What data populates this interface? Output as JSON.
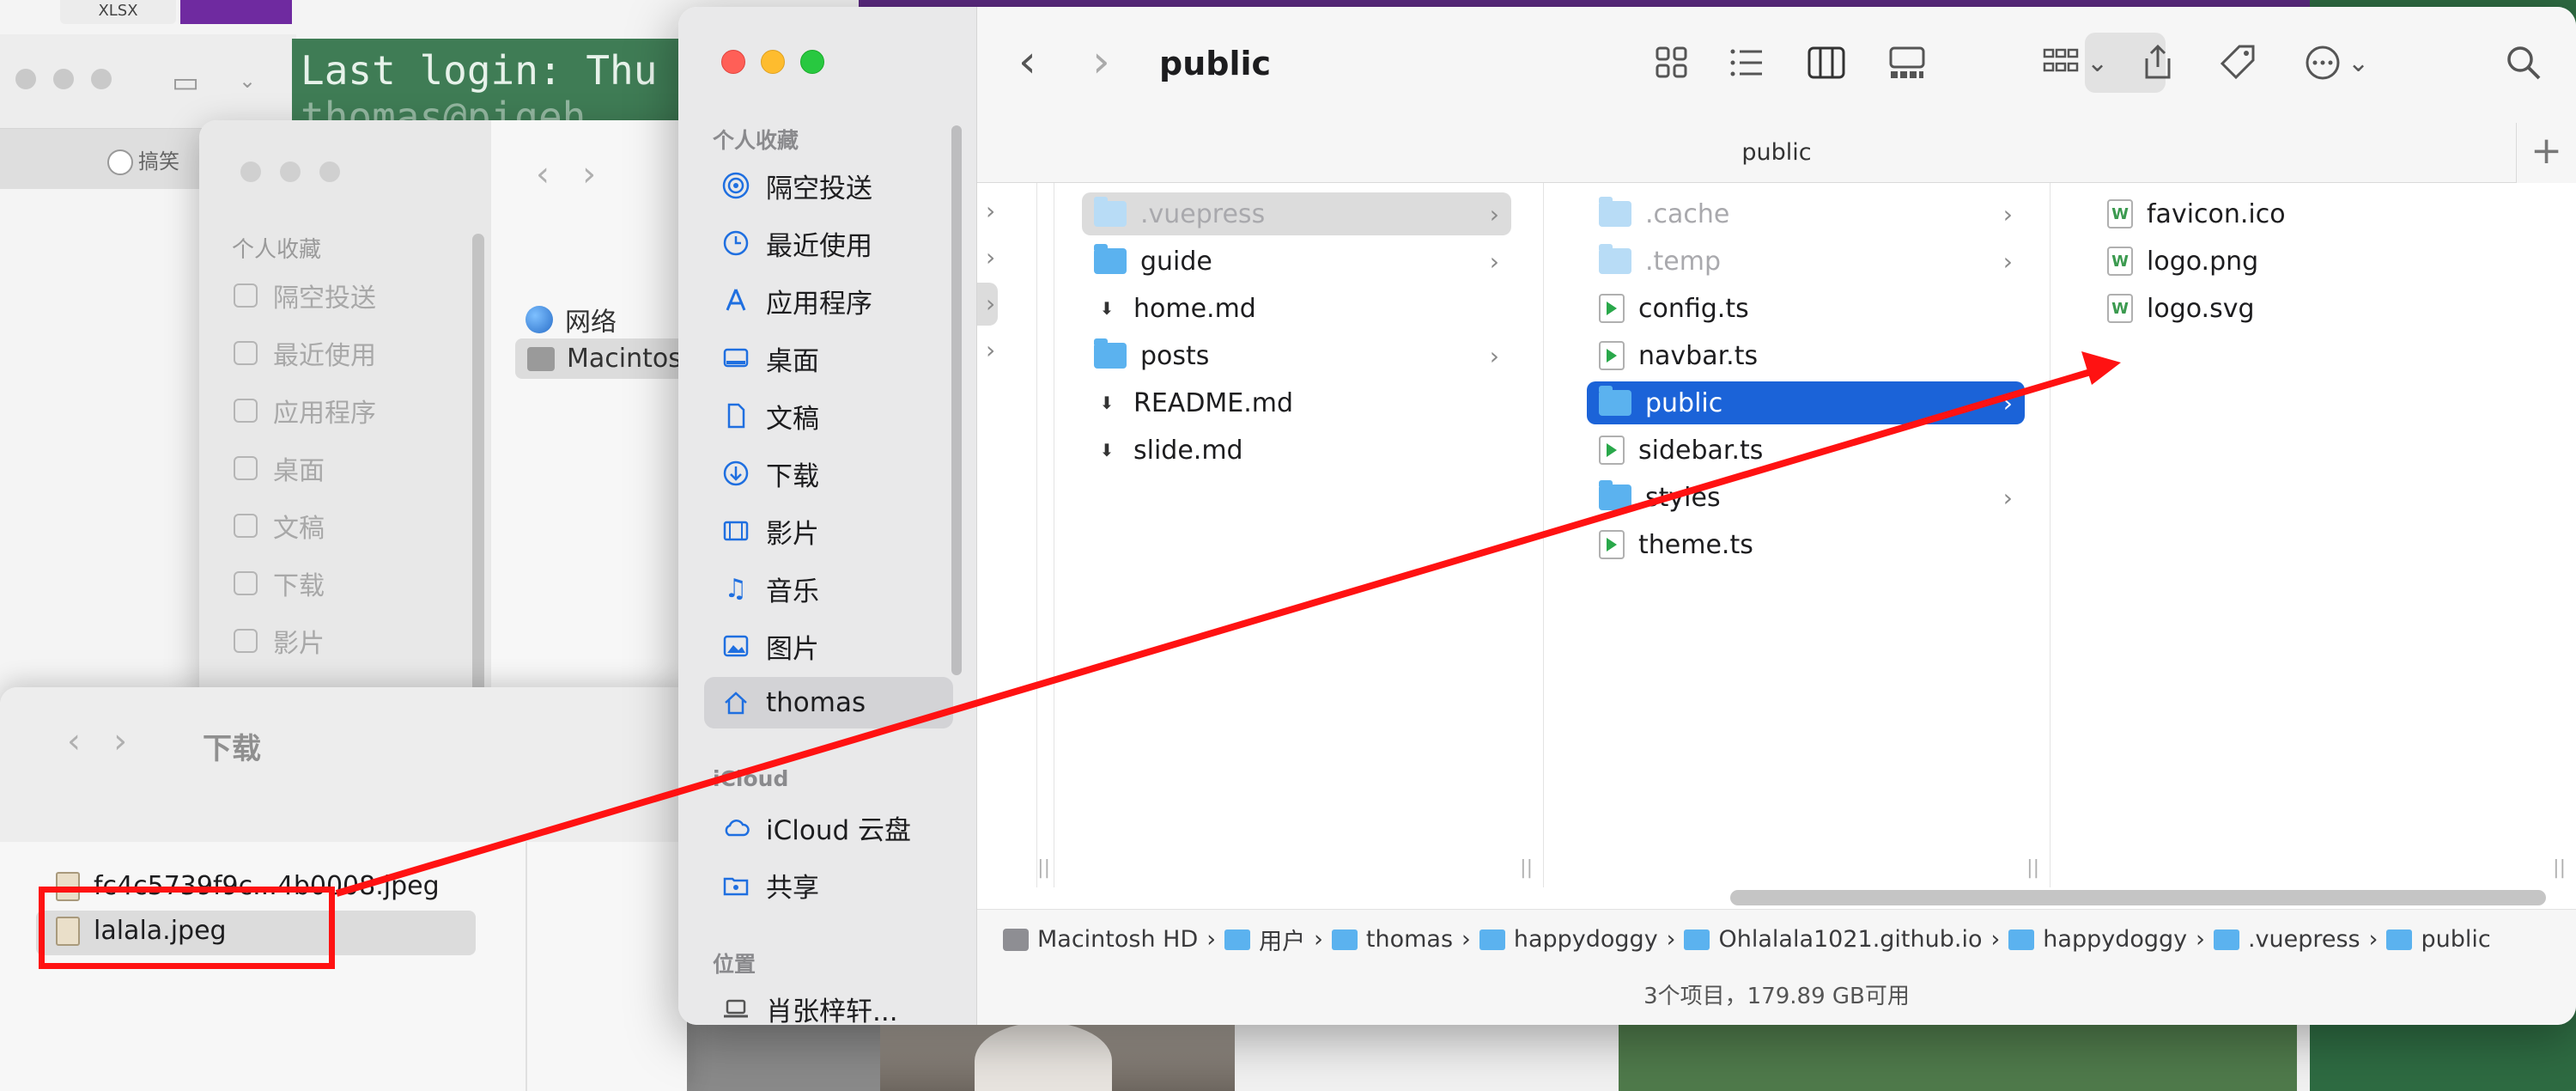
{
  "desktop": {
    "xlsx_chip": "XLSX",
    "baidu_tab": "搞笑",
    "terminal": {
      "line1": "Last login: Thu",
      "line2": "thomas@pigeh"
    }
  },
  "mid_window": {
    "sidebar_title": "个人收藏",
    "sidebar_items": [
      "隔空投送",
      "最近使用",
      "应用程序",
      "桌面",
      "文稿",
      "下载",
      "影片"
    ],
    "content_items": [
      "网络",
      "Macintos"
    ]
  },
  "downloads_window": {
    "title": "下载",
    "files": [
      "fc4c5739f9c...4b0008.jpeg",
      "lalala.jpeg"
    ],
    "selected_file": "lalala.jpeg"
  },
  "main_window": {
    "title": "public",
    "path_title": "public",
    "toolbar": {
      "back": "back-icon",
      "forward": "forward-icon",
      "view_icons": "icon-view-icon",
      "view_list": "list-view-icon",
      "view_columns": "column-view-icon",
      "view_gallery": "gallery-view-icon",
      "group": "group-icon",
      "share": "share-icon",
      "tag": "tag-icon",
      "more": "more-icon",
      "search": "search-icon"
    },
    "sidebar": {
      "favorites_title": "个人收藏",
      "favorites": [
        {
          "label": "隔空投送",
          "icon": "airdrop-icon"
        },
        {
          "label": "最近使用",
          "icon": "clock-icon"
        },
        {
          "label": "应用程序",
          "icon": "applications-icon"
        },
        {
          "label": "桌面",
          "icon": "desktop-icon"
        },
        {
          "label": "文稿",
          "icon": "document-icon"
        },
        {
          "label": "下载",
          "icon": "download-icon"
        },
        {
          "label": "影片",
          "icon": "film-icon"
        },
        {
          "label": "音乐",
          "icon": "music-icon"
        },
        {
          "label": "图片",
          "icon": "photo-icon"
        },
        {
          "label": "thomas",
          "icon": "home-icon"
        }
      ],
      "icloud_title": "iCloud",
      "icloud": [
        {
          "label": "iCloud 云盘",
          "icon": "cloud-icon"
        },
        {
          "label": "共享",
          "icon": "shared-folder-icon"
        }
      ],
      "locations_title": "位置",
      "locations": [
        {
          "label": "肖张梓轩...",
          "icon": "laptop-icon"
        }
      ]
    },
    "col2": [
      {
        "name": ".vuepress",
        "type": "folder",
        "dim": true,
        "highlight": "grey"
      },
      {
        "name": "guide",
        "type": "folder"
      },
      {
        "name": "home.md",
        "type": "md"
      },
      {
        "name": "posts",
        "type": "folder"
      },
      {
        "name": "README.md",
        "type": "md"
      },
      {
        "name": "slide.md",
        "type": "md"
      }
    ],
    "col3": [
      {
        "name": ".cache",
        "type": "folder",
        "dim": true
      },
      {
        "name": ".temp",
        "type": "folder",
        "dim": true
      },
      {
        "name": "config.ts",
        "type": "ts"
      },
      {
        "name": "navbar.ts",
        "type": "ts"
      },
      {
        "name": "public",
        "type": "folder",
        "highlight": "blue"
      },
      {
        "name": "sidebar.ts",
        "type": "ts"
      },
      {
        "name": "styles",
        "type": "folder"
      },
      {
        "name": "theme.ts",
        "type": "ts"
      }
    ],
    "col4": [
      {
        "name": "favicon.ico",
        "type": "image"
      },
      {
        "name": "logo.png",
        "type": "image"
      },
      {
        "name": "logo.svg",
        "type": "image"
      }
    ],
    "breadcrumbs": [
      "Macintosh HD",
      "用户",
      "thomas",
      "happydoggy",
      "Ohlalala1021.github.io",
      "happydoggy",
      ".vuepress",
      "public"
    ],
    "status": "3个项目，179.89 GB可用"
  },
  "colors": {
    "selection_blue": "#1b63d8",
    "annotation_red": "#ff1212",
    "folder_blue": "#5bb2ef"
  }
}
